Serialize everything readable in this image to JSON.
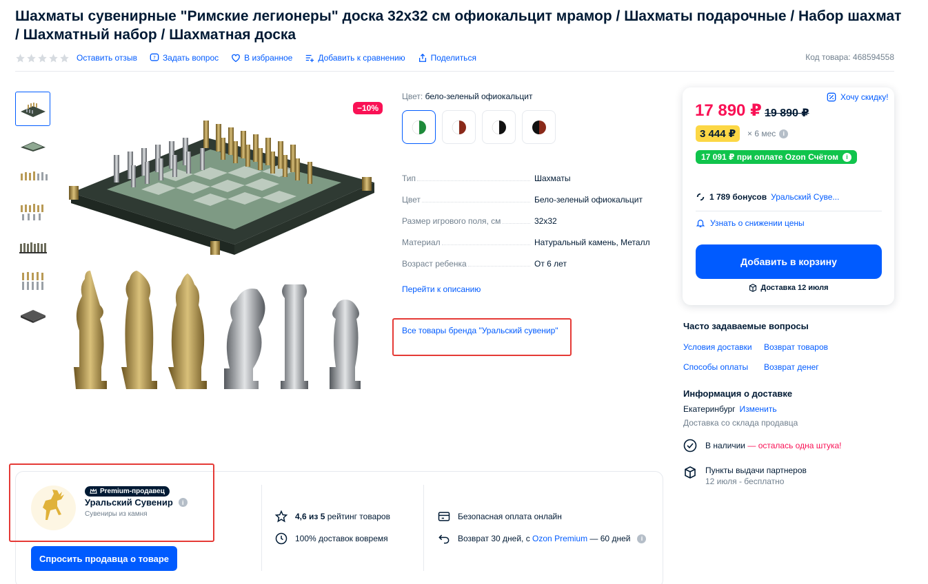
{
  "product": {
    "title": "Шахматы сувенирные \"Римские легионеры\" доска 32x32 см офиокальцит мрамор / Шахматы подарочные / Набор шахмат / Шахматный набор / Шахматная доска",
    "code": "Код товара: 468594558",
    "discount_badge": "−10%"
  },
  "actions": {
    "review": "Оставить отзыв",
    "question": "Задать вопрос",
    "favorite": "В избранное",
    "compare": "Добавить к сравнению",
    "share": "Поделиться"
  },
  "color": {
    "label": "Цвет:",
    "value": "бело-зеленый офиокальцит",
    "swatches": [
      {
        "left": "#ffffff",
        "right": "#1e8a3a"
      },
      {
        "left": "#ffffff",
        "right": "#8a2a1a"
      },
      {
        "left": "#ffffff",
        "right": "#111111"
      },
      {
        "left": "#111111",
        "right": "#8a2a1a"
      }
    ]
  },
  "specs": [
    {
      "key": "Тип",
      "value": "Шахматы"
    },
    {
      "key": "Цвет",
      "value": "Бело-зеленый офиокальцит"
    },
    {
      "key": "Размер игрового поля, см",
      "value": "32x32"
    },
    {
      "key": "Материал",
      "value": "Натуральный камень, Металл"
    },
    {
      "key": "Возраст ребенка",
      "value": "От 6 лет"
    }
  ],
  "links": {
    "to_description": "Перейти к описанию",
    "brand_all": "Все товары бренда \"Уральский сувенир\""
  },
  "price": {
    "current": "17 890 ₽",
    "old": "19 890 ₽",
    "want_discount": "Хочу скидку!",
    "installment": "3 444 ₽",
    "installment_term": "× 6 мес",
    "ozon_account": "17 091 ₽ при оплате Ozon Счётом",
    "bonus_count": "1 789 бонусов",
    "bonus_seller": "Уральский Суве...",
    "notify": "Узнать о снижении цены",
    "add_to_cart": "Добавить в корзину",
    "delivery": "Доставка 12 июля"
  },
  "faq": {
    "title": "Часто задаваемые вопросы",
    "items": [
      "Условия доставки",
      "Возврат товаров",
      "Способы оплаты",
      "Возврат денег"
    ]
  },
  "delivery": {
    "title": "Информация о доставке",
    "city": "Екатеринбург",
    "change": "Изменить",
    "from": "Доставка со склада продавца",
    "stock": "В наличии",
    "stock_warn": "— осталась одна штука!",
    "pickup": "Пункты выдачи партнеров",
    "pickup_sub": "12 июля - бесплатно"
  },
  "seller": {
    "badge": "Premium-продавец",
    "name": "Уральский Сувенир",
    "subtitle": "Сувениры из камня",
    "ask": "Спросить продавца о товаре",
    "rating_bold": "4,6 из 5",
    "rating_rest": "рейтинг товаров",
    "ontime": "100% доставок вовремя",
    "safe_pay": "Безопасная оплата онлайн",
    "return_prefix": "Возврат 30 дней, с",
    "return_link": "Ozon Premium",
    "return_suffix": "— 60 дней"
  },
  "colors": {
    "accent": "#005bff",
    "price": "#f91155",
    "green": "#10c44c",
    "yellow": "#fcd745"
  }
}
